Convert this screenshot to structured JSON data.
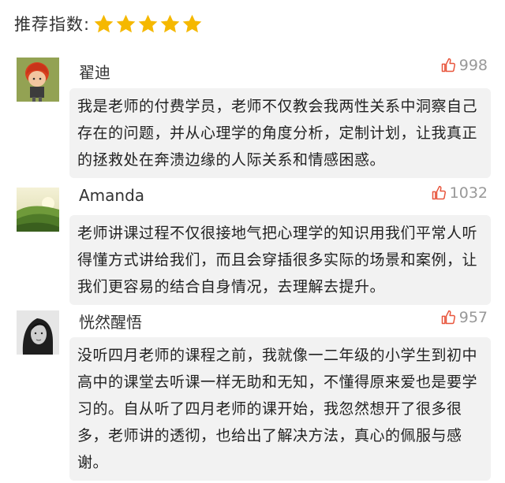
{
  "rating": {
    "label": "推荐指数:",
    "stars": 5,
    "star_color": "#f5b800"
  },
  "comments": [
    {
      "username": "翟迪",
      "likes": "998",
      "avatar": "cartoon-red-hair-avatar",
      "text": "我是老师的付费学员，老师不仅教会我两性关系中洞察自己存在的问题，并从心理学的角度分析，定制计划，让我真正的拯救处在奔溃边缘的人际关系和情感困惑。"
    },
    {
      "username": "Amanda",
      "likes": "1032",
      "avatar": "green-hills-landscape-avatar",
      "text": "老师讲课过程不仅很接地气把心理学的知识用我们平常人听得懂方式讲给我们，而且会穿插很多实际的场景和案例，让我们更容易的结合自身情况，去理解去提升。"
    },
    {
      "username": "恍然醒悟",
      "likes": "957",
      "avatar": "black-white-portrait-avatar",
      "text": "没听四月老师的课程之前，我就像一二年级的小学生到初中高中的课堂去听课一样无助和无知，不懂得原来爱也是要学习的。自从听了四月老师的课开始，我忽然想开了很多很多，老师讲的透彻，也给出了解决方法，真心的佩服与感谢。"
    }
  ],
  "colors": {
    "like_icon": "#e8553c",
    "bubble_bg": "#f2f2f2",
    "likes_text": "#999999"
  }
}
